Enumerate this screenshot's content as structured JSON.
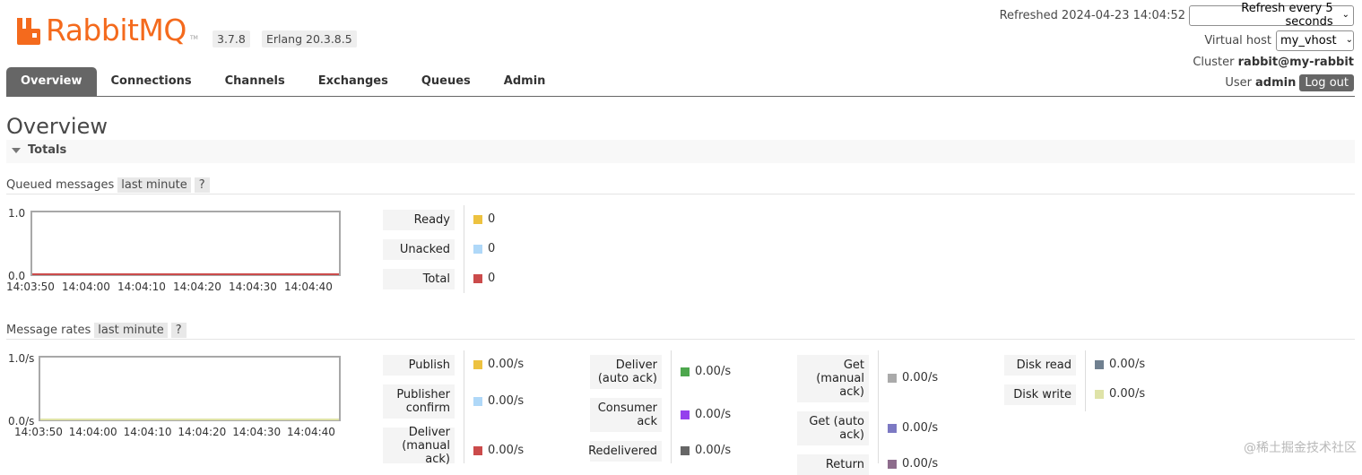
{
  "header": {
    "logo_text": "RabbitMQ",
    "logo_tm": "TM",
    "version": "3.7.8",
    "erlang": "Erlang 20.3.8.5",
    "refreshed_label": "Refreshed",
    "refreshed_time": "2024-04-23 14:04:52",
    "refresh_select": "Refresh every 5 seconds",
    "vhost_label": "Virtual host",
    "vhost_select": "my_vhost",
    "cluster_label": "Cluster",
    "cluster_name": "rabbit@my-rabbit",
    "user_label": "User",
    "user_name": "admin",
    "logout": "Log out",
    "brand_color": "#f46a1d"
  },
  "tabs": [
    "Overview",
    "Connections",
    "Channels",
    "Exchanges",
    "Queues",
    "Admin"
  ],
  "page_title": "Overview",
  "totals_label": "Totals",
  "queued": {
    "title": "Queued messages",
    "range": "last minute",
    "help": "?",
    "legend": [
      {
        "label": "Ready",
        "value": "0",
        "color": "#edc240"
      },
      {
        "label": "Unacked",
        "value": "0",
        "color": "#afd8f8"
      },
      {
        "label": "Total",
        "value": "0",
        "color": "#cb4b4b"
      }
    ]
  },
  "rates": {
    "title": "Message rates",
    "range": "last minute",
    "help": "?",
    "col1": [
      {
        "label": "Publish",
        "value": "0.00/s",
        "color": "#edc240"
      },
      {
        "label": "Publisher confirm",
        "value": "0.00/s",
        "color": "#afd8f8"
      },
      {
        "label": "Deliver (manual ack)",
        "value": "0.00/s",
        "color": "#cb4b4b"
      }
    ],
    "col2": [
      {
        "label": "Deliver (auto ack)",
        "value": "0.00/s",
        "color": "#4da74d"
      },
      {
        "label": "Consumer ack",
        "value": "0.00/s",
        "color": "#9440ed"
      },
      {
        "label": "Redelivered",
        "value": "0.00/s",
        "color": "#666666"
      }
    ],
    "col3": [
      {
        "label": "Get (manual ack)",
        "value": "0.00/s",
        "color": "#aaaaaa"
      },
      {
        "label": "Get (auto ack)",
        "value": "0.00/s",
        "color": "#7c79c3"
      },
      {
        "label": "Return",
        "value": "0.00/s",
        "color": "#8d6c8c"
      }
    ],
    "col4": [
      {
        "label": "Disk read",
        "value": "0.00/s",
        "color": "#708090"
      },
      {
        "label": "Disk write",
        "value": "0.00/s",
        "color": "#dfe3a8"
      }
    ]
  },
  "chart_data": [
    {
      "type": "line",
      "x": [
        "14:03:50",
        "14:04:00",
        "14:04:10",
        "14:04:20",
        "14:04:30",
        "14:04:40"
      ],
      "series": [
        {
          "name": "Ready",
          "values": [
            0,
            0,
            0,
            0,
            0,
            0
          ]
        },
        {
          "name": "Unacked",
          "values": [
            0,
            0,
            0,
            0,
            0,
            0
          ]
        },
        {
          "name": "Total",
          "values": [
            0,
            0,
            0,
            0,
            0,
            0
          ]
        }
      ],
      "ylim": [
        0,
        1
      ],
      "yticks": [
        "0.0",
        "1.0"
      ],
      "grid": false
    },
    {
      "type": "line",
      "x": [
        "14:03:50",
        "14:04:00",
        "14:04:10",
        "14:04:20",
        "14:04:30",
        "14:04:40"
      ],
      "series": [
        {
          "name": "Publish",
          "values": [
            0,
            0,
            0,
            0,
            0,
            0
          ]
        },
        {
          "name": "Publisher confirm",
          "values": [
            0,
            0,
            0,
            0,
            0,
            0
          ]
        },
        {
          "name": "Disk write",
          "values": [
            0,
            0,
            0,
            0,
            0,
            0
          ]
        }
      ],
      "ylim": [
        0,
        1
      ],
      "yticks": [
        "0.0/s",
        "1.0/s"
      ],
      "grid": false
    }
  ],
  "watermark": "@稀土掘金技术社区"
}
